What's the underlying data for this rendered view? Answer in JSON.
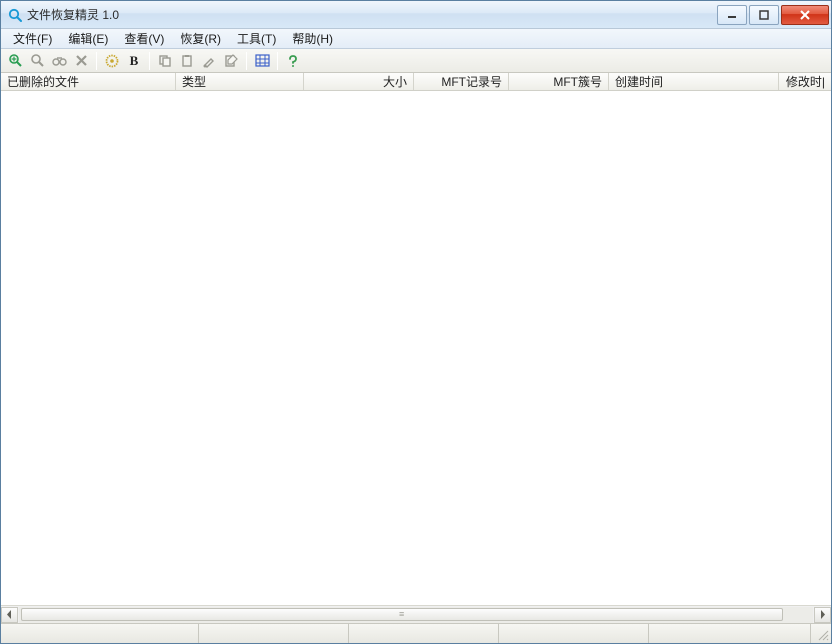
{
  "window": {
    "title": "文件恢复精灵 1.0"
  },
  "menu": {
    "file": "文件(F)",
    "edit": "编辑(E)",
    "view": "查看(V)",
    "recover": "恢复(R)",
    "tools": "工具(T)",
    "help": "帮助(H)"
  },
  "columns": {
    "deleted_file": "已删除的文件",
    "type": "类型",
    "size": "大小",
    "mft_record": "MFT记录号",
    "mft_cluster": "MFT簇号",
    "create_time": "创建时间",
    "modify_time": "修改时|"
  },
  "column_widths": {
    "deleted_file": 175,
    "type": 128,
    "size": 110,
    "mft_record": 95,
    "mft_cluster": 100,
    "create_time": 170,
    "modify_time": 50
  },
  "colors": {
    "titlebar_top": "#f0f6fc",
    "titlebar_bottom": "#d8e8f7",
    "close_btn": "#d03318",
    "border": "#5a7fa0"
  }
}
